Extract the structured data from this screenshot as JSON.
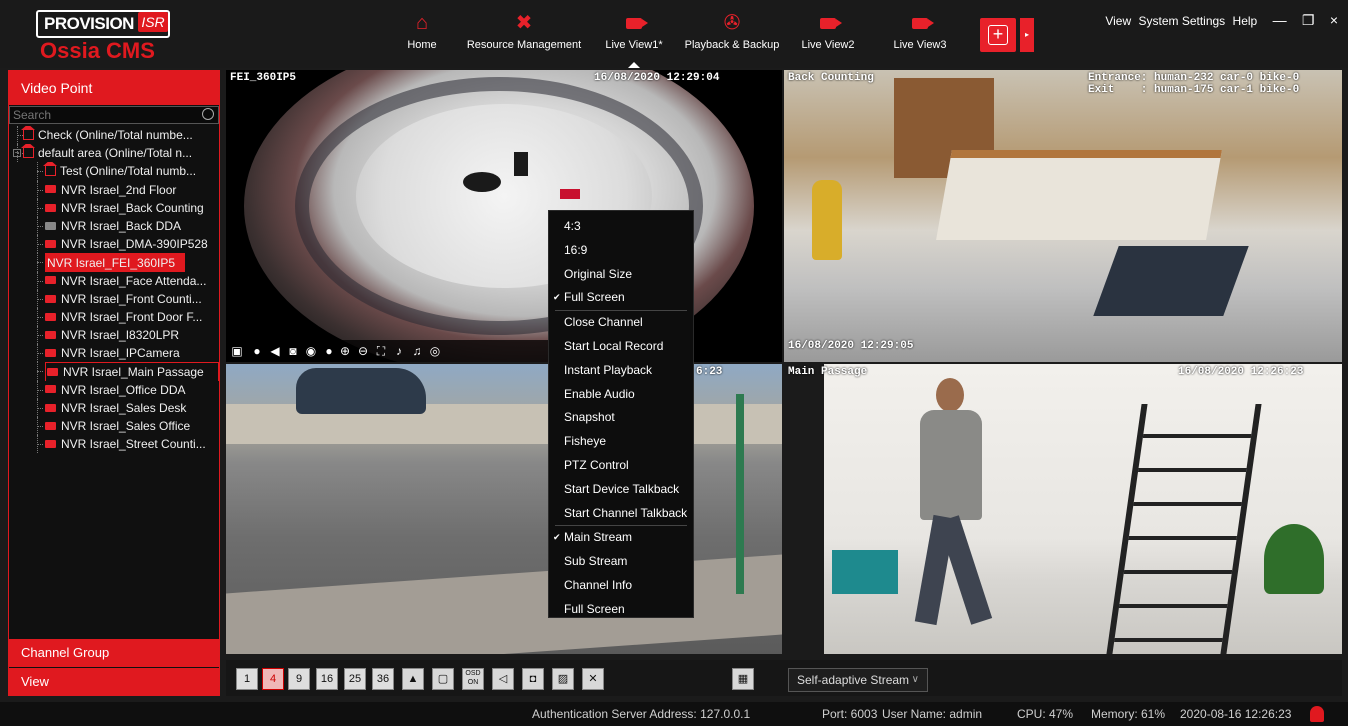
{
  "app": {
    "brand": "PROVISION",
    "brand_badge": "ISR",
    "product": "Ossia CMS"
  },
  "nav": [
    {
      "label": "Home",
      "icon": "home-icon"
    },
    {
      "label": "Resource Management",
      "icon": "tools-icon"
    },
    {
      "label": "Live View1*",
      "icon": "camera-icon",
      "active": true
    },
    {
      "label": "Playback & Backup",
      "icon": "film-reel-icon"
    },
    {
      "label": "Live View2",
      "icon": "camera-icon"
    },
    {
      "label": "Live View3",
      "icon": "camera-icon"
    }
  ],
  "system_menu": {
    "view": "View",
    "settings": "System Settings",
    "help": "Help",
    "minimize": "—",
    "restore": "❐",
    "close": "×"
  },
  "sidebar": {
    "title": "Video Point",
    "search_placeholder": "Search",
    "tree": [
      {
        "label": "Check (Online/Total numbe...",
        "type": "area",
        "level": 0
      },
      {
        "label": "default area (Online/Total n...",
        "type": "area",
        "level": 0,
        "expand": "−"
      },
      {
        "label": "Test (Online/Total numb...",
        "type": "area",
        "level": 1
      },
      {
        "label": "NVR Israel_2nd Floor",
        "type": "device",
        "level": 1
      },
      {
        "label": "NVR Israel_Back Counting",
        "type": "device",
        "level": 1
      },
      {
        "label": "NVR Israel_Back DDA",
        "type": "device-offline",
        "level": 1
      },
      {
        "label": "NVR Israel_DMA-390IP528",
        "type": "device",
        "level": 1
      },
      {
        "label": "NVR Israel_FEI_360IP5",
        "type": "device",
        "level": 1,
        "selected": true
      },
      {
        "label": "NVR Israel_Face Attenda...",
        "type": "device",
        "level": 1
      },
      {
        "label": "NVR Israel_Front Counti...",
        "type": "device",
        "level": 1
      },
      {
        "label": "NVR Israel_Front Door F...",
        "type": "device",
        "level": 1
      },
      {
        "label": "NVR Israel_I8320LPR",
        "type": "device",
        "level": 1
      },
      {
        "label": "NVR Israel_IPCamera",
        "type": "device",
        "level": 1
      },
      {
        "label": "NVR Israel_Main Passage",
        "type": "device",
        "level": 1,
        "outlined": true
      },
      {
        "label": "NVR Israel_Office DDA",
        "type": "device",
        "level": 1
      },
      {
        "label": "NVR Israel_Sales Desk",
        "type": "device",
        "level": 1
      },
      {
        "label": "NVR Israel_Sales Office",
        "type": "device",
        "level": 1
      },
      {
        "label": "NVR Israel_Street Counti...",
        "type": "device",
        "level": 1
      }
    ],
    "channel_group": "Channel Group",
    "view": "View"
  },
  "panes": {
    "p1": {
      "name": "FEI_360IP5",
      "time": "16/08/2020 12:29:04"
    },
    "p2": {
      "name": "Back Counting",
      "count1": "Entrance: human-232 car-0 bike-0",
      "count2": "Exit    : human-175 car-1 bike-0",
      "time": "16/08/2020 12:29:05"
    },
    "p3": {
      "time_fragment": "6:23"
    },
    "p4": {
      "name": "Main Passage",
      "time": "16/08/2020 12:26:23"
    }
  },
  "context_menu": {
    "items": [
      {
        "label": "4:3"
      },
      {
        "label": "16:9"
      },
      {
        "label": "Original Size"
      },
      {
        "label": "Full Screen",
        "checked": true
      },
      {
        "sep": true
      },
      {
        "label": "Close Channel"
      },
      {
        "label": "Start Local Record"
      },
      {
        "label": "Instant Playback"
      },
      {
        "label": "Enable Audio"
      },
      {
        "label": "Snapshot"
      },
      {
        "label": "Fisheye"
      },
      {
        "label": "PTZ Control"
      },
      {
        "label": "Start Device Talkback"
      },
      {
        "label": "Start Channel Talkback"
      },
      {
        "sep": true
      },
      {
        "label": "Main Stream",
        "checked": true
      },
      {
        "label": "Sub Stream"
      },
      {
        "label": "Channel Info"
      },
      {
        "label": "Full Screen"
      }
    ]
  },
  "bottom_toolbar": {
    "layouts": [
      "1",
      "4",
      "9",
      "16",
      "25",
      "36"
    ],
    "active_layout": "4",
    "osd_label": "OSD\nON",
    "stream_select": "Self-adaptive Stream"
  },
  "status": {
    "auth_server": "Authentication Server  Address: 127.0.0.1",
    "port": "Port: 6003",
    "user": "User Name: admin",
    "cpu": "CPU: 47%",
    "memory": "Memory: 61%",
    "datetime": "2020-08-16 12:26:23"
  },
  "colors": {
    "accent": "#e0191f",
    "background": "#1b1b1b"
  }
}
